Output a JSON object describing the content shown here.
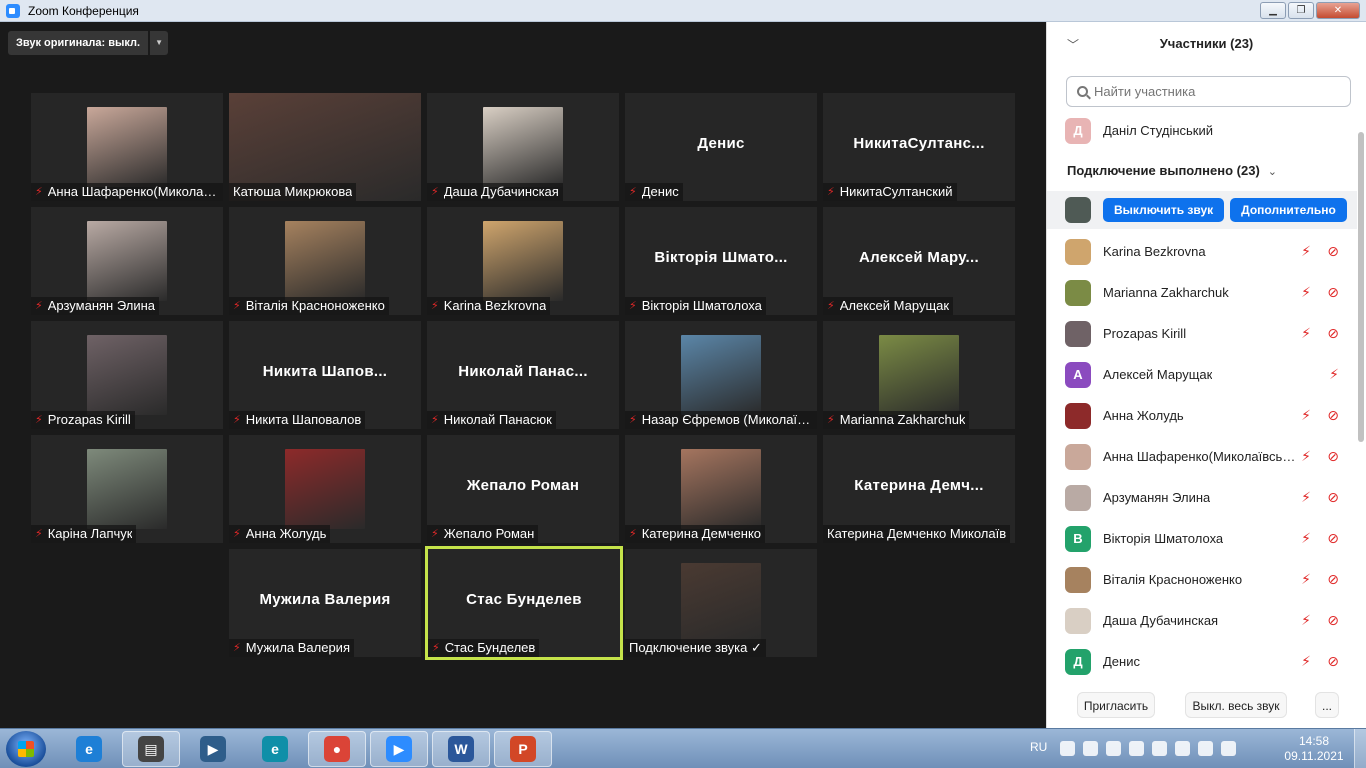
{
  "window": {
    "title": "Zoom Конференция"
  },
  "toolbar": {
    "original_sound": "Звук оригинала: выкл."
  },
  "tiles": [
    {
      "big": "",
      "label": "Анна Шафаренко(Миколаївськ",
      "muted": true,
      "photo": "#c9a89a"
    },
    {
      "big": "",
      "label": "Катюша Микрюкова",
      "muted": false,
      "photo": "#5a4038"
    },
    {
      "big": "",
      "label": "Даша Дубачинская",
      "muted": true,
      "photo": "#d9cfc4"
    },
    {
      "big": "Денис",
      "label": "Денис",
      "muted": true,
      "photo": ""
    },
    {
      "big": "НикитаСултанс...",
      "label": "НикитаСултанский",
      "muted": true,
      "photo": ""
    },
    {
      "big": "",
      "label": "Арзуманян Элина",
      "muted": true,
      "photo": "#b9aaa4"
    },
    {
      "big": "",
      "label": "Віталія Красноноженко",
      "muted": true,
      "photo": "#a6825f"
    },
    {
      "big": "",
      "label": "Karina Bezkrovna",
      "muted": true,
      "photo": "#cfa56d"
    },
    {
      "big": "Вікторія Шмато...",
      "label": "Вікторія Шматолоха",
      "muted": true,
      "photo": ""
    },
    {
      "big": "Алексей Мару...",
      "label": "Алексей Марущак",
      "muted": true,
      "photo": ""
    },
    {
      "big": "",
      "label": "Prozapas Kirill",
      "muted": true,
      "photo": "#6f6266"
    },
    {
      "big": "Никита Шапов...",
      "label": "Никита Шаповалов",
      "muted": true,
      "photo": ""
    },
    {
      "big": "Николай Панас...",
      "label": "Николай Панасюк",
      "muted": true,
      "photo": ""
    },
    {
      "big": "",
      "label": "Назар Єфремов (Миколаївськ",
      "muted": true,
      "photo": "#5b86a8"
    },
    {
      "big": "",
      "label": "Marianna Zakharchuk",
      "muted": true,
      "photo": "#7b8b45"
    },
    {
      "big": "",
      "label": "Каріна Лапчук",
      "muted": true,
      "photo": "#7e8a7b"
    },
    {
      "big": "",
      "label": "Анна Жолудь",
      "muted": true,
      "photo": "#8d2a2a"
    },
    {
      "big": "Жепало Роман",
      "label": "Жепало Роман",
      "muted": true,
      "photo": ""
    },
    {
      "big": "",
      "label": "Катерина Демченко",
      "muted": true,
      "photo": "#a5755f"
    },
    {
      "big": "Катерина Демч...",
      "label": "Катерина Демченко Миколаїв",
      "muted": false,
      "photo": ""
    },
    {
      "big": "Мужила Валерия",
      "label": "Мужила Валерия",
      "muted": true,
      "photo": ""
    },
    {
      "big": "Стас Бунделев",
      "label": "Стас Бунделев",
      "muted": true,
      "photo": ""
    },
    {
      "big": "",
      "label": "Подключение звука ✓",
      "muted": false,
      "photo": "#4a3a32"
    }
  ],
  "panel": {
    "title": "Участники (23)",
    "search_placeholder": "Найти участника",
    "waiting": {
      "initial": "Д",
      "name": "Даніл Студінський"
    },
    "section": "Подключение выполнено (23)",
    "host_buttons": {
      "mute": "Выключить звук",
      "more": "Дополнительно"
    },
    "participants": [
      {
        "name": "Karina Bezkrovna",
        "initial": "",
        "color": "#cfa56d",
        "mic": true
      },
      {
        "name": "Marianna Zakharchuk",
        "initial": "",
        "color": "#7b8b45",
        "mic": true
      },
      {
        "name": "Prozapas Kirill",
        "initial": "",
        "color": "#6f6266",
        "mic": true
      },
      {
        "name": "Алексей Марущак",
        "initial": "А",
        "color": "#8b4bbf",
        "mic": true
      },
      {
        "name": "Анна Жолудь",
        "initial": "",
        "color": "#8d2a2a",
        "mic": true
      },
      {
        "name": "Анна Шафаренко(Миколаївськ...",
        "initial": "",
        "color": "#c9a89a",
        "mic": true
      },
      {
        "name": "Арзуманян Элина",
        "initial": "",
        "color": "#b9aaa4",
        "mic": true
      },
      {
        "name": "Вікторія Шматолоха",
        "initial": "В",
        "color": "#23a26b",
        "mic": true
      },
      {
        "name": "Віталія Красноноженко",
        "initial": "",
        "color": "#a6825f",
        "mic": true
      },
      {
        "name": "Даша Дубачинская",
        "initial": "",
        "color": "#d9cfc4",
        "mic": true
      },
      {
        "name": "Денис",
        "initial": "Д",
        "color": "#23a26b",
        "mic": true
      }
    ],
    "footer": {
      "invite": "Пригласить",
      "mute_all": "Выкл. весь звук",
      "more": "..."
    }
  },
  "taskbar": {
    "apps": [
      {
        "name": "ie-icon",
        "glyph": "e",
        "color": "#1e7fd6",
        "open": false
      },
      {
        "name": "scanner-icon",
        "glyph": "▤",
        "color": "#444",
        "open": true
      },
      {
        "name": "media-player-icon",
        "glyph": "▶",
        "color": "#2e5d8a",
        "open": false
      },
      {
        "name": "edge-icon",
        "glyph": "e",
        "color": "#0f8fa8",
        "open": false
      },
      {
        "name": "chrome-icon",
        "glyph": "●",
        "color": "#db4437",
        "open": true
      },
      {
        "name": "zoom-icon",
        "glyph": "▶",
        "color": "#2d8cff",
        "open": true
      },
      {
        "name": "word-icon",
        "glyph": "W",
        "color": "#2b579a",
        "open": true
      },
      {
        "name": "powerpoint-icon",
        "glyph": "P",
        "color": "#d24726",
        "open": true
      }
    ],
    "lang": "RU",
    "time": "14:58",
    "date": "09.11.2021"
  }
}
